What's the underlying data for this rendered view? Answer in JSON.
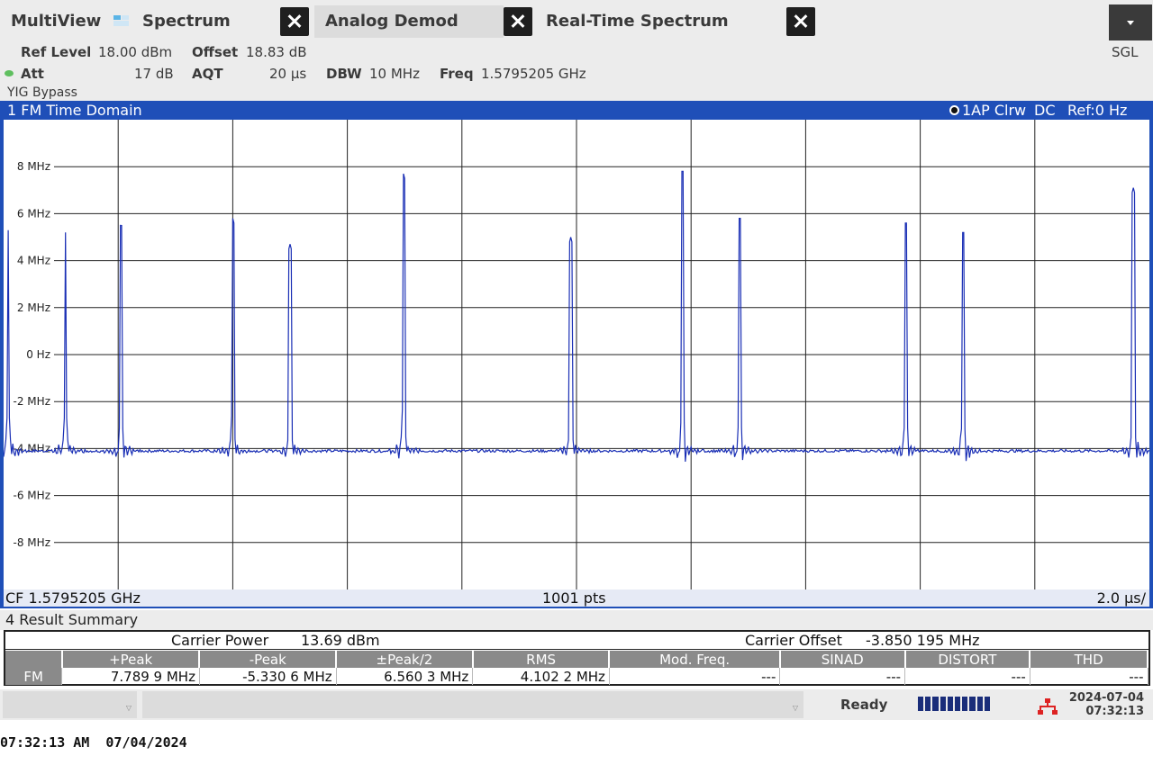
{
  "tabs": [
    {
      "label": "MultiView"
    },
    {
      "label": "Spectrum"
    },
    {
      "label": "Analog Demod"
    },
    {
      "label": "Real-Time Spectrum"
    }
  ],
  "sweep_mode": "SGL",
  "settings": {
    "ref_level_label": "Ref Level",
    "ref_level_value": "18.00 dBm",
    "offset_label": "Offset",
    "offset_value": "18.83 dB",
    "att_label": "Att",
    "att_value": "17 dB",
    "aqt_label": "AQT",
    "aqt_value": "20 µs",
    "dbw_label": "DBW",
    "dbw_value": "10 MHz",
    "freq_label": "Freq",
    "freq_value": "1.5795205 GHz",
    "yig": "YIG Bypass"
  },
  "window1": {
    "title": "1 FM Time Domain",
    "trace_info": "1AP Clrw",
    "coupling": "DC",
    "ref": "Ref:0 Hz",
    "footer_left": "CF 1.5795205 GHz",
    "footer_center": "1001 pts",
    "footer_right": "2.0 µs/"
  },
  "chart_data": {
    "type": "line",
    "ylabel_ticks": [
      "8 MHz",
      "6 MHz",
      "4 MHz",
      "2 MHz",
      "0 Hz",
      "-2 MHz",
      "-4 MHz",
      "-6 MHz",
      "-8 MHz"
    ],
    "ylim": [
      -10,
      10
    ],
    "y_unit": "MHz",
    "xlim": [
      0,
      20
    ],
    "x_unit": "µs",
    "grid": true,
    "trace_color": "#1a2fb5",
    "baseline": -4.1,
    "spikes": [
      {
        "t": 0.08,
        "peak": 5.3
      },
      {
        "t": 1.08,
        "peak": 5.2
      },
      {
        "t": 2.05,
        "peak": 5.6
      },
      {
        "t": 4.0,
        "peak": 5.8
      },
      {
        "t": 5.0,
        "peak": 4.7
      },
      {
        "t": 6.98,
        "peak": 7.7
      },
      {
        "t": 9.9,
        "peak": 5.0
      },
      {
        "t": 11.85,
        "peak": 7.9
      },
      {
        "t": 12.85,
        "peak": 5.9
      },
      {
        "t": 15.75,
        "peak": 5.7
      },
      {
        "t": 16.75,
        "peak": 5.3
      },
      {
        "t": 19.72,
        "peak": 7.1
      }
    ]
  },
  "result_summary": {
    "title": "4 Result Summary",
    "carrier_power_label": "Carrier Power",
    "carrier_power_value": "13.69 dBm",
    "carrier_offset_label": "Carrier Offset",
    "carrier_offset_value": "-3.850 195 MHz",
    "headers": [
      "+Peak",
      "-Peak",
      "±Peak/2",
      "RMS",
      "Mod. Freq.",
      "SINAD",
      "DISTORT",
      "THD"
    ],
    "row_label": "FM",
    "row_values": [
      "7.789 9 MHz",
      "-5.330 6 MHz",
      "6.560 3 MHz",
      "4.102 2 MHz",
      "---",
      "---",
      "---",
      "---"
    ]
  },
  "status": {
    "state": "Ready",
    "date": "2024-07-04",
    "time": "07:32:13"
  },
  "bottom_clock": "07:32:13 AM  07/04/2024"
}
